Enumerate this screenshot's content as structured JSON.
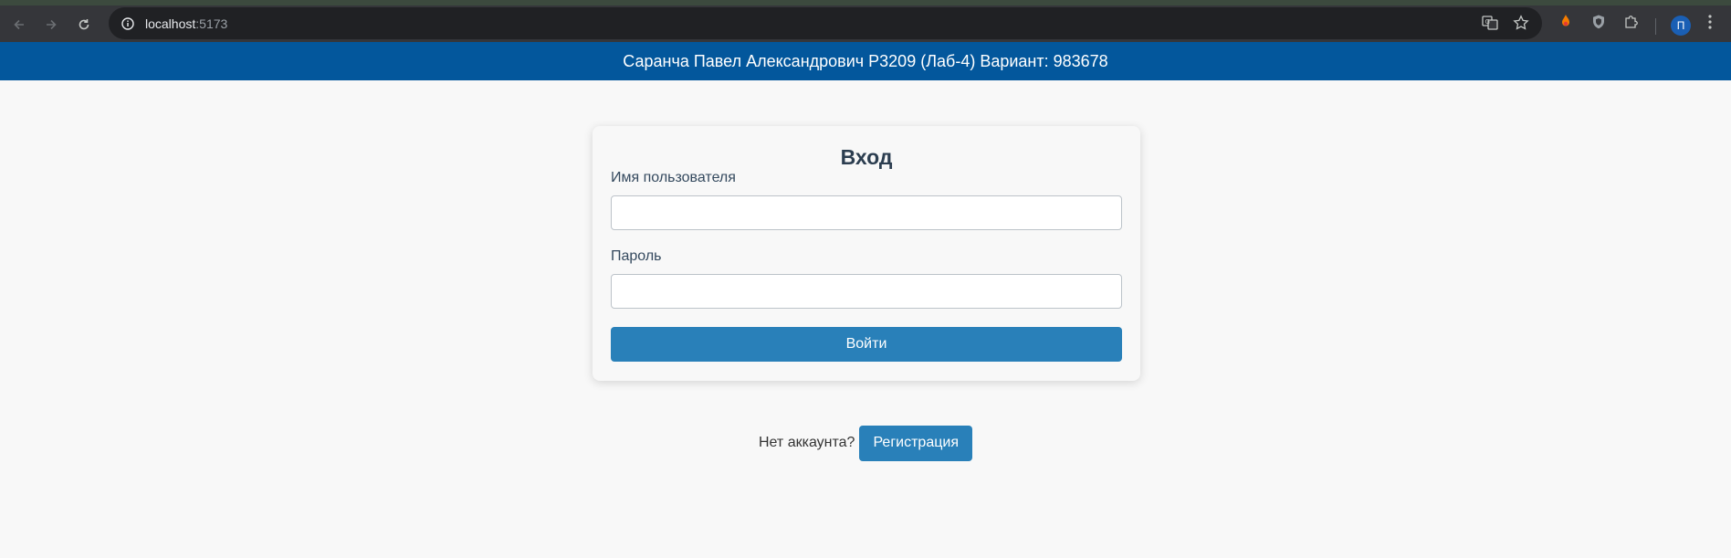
{
  "browser": {
    "url_host": "localhost",
    "url_port": ":5173",
    "profile_initial": "П"
  },
  "header": {
    "title": "Саранча Павел Александрович Р3209 (Лаб-4) Вариант: 983678"
  },
  "login": {
    "title": "Вход",
    "username_label": "Имя пользователя",
    "username_value": "",
    "password_label": "Пароль",
    "password_value": "",
    "submit_label": "Войти"
  },
  "register": {
    "prompt": "Нет аккаунта?",
    "button_label": "Регистрация"
  },
  "colors": {
    "header_bg": "#03579c",
    "button_bg": "#2980b9",
    "page_bg": "#f8f8f8"
  }
}
